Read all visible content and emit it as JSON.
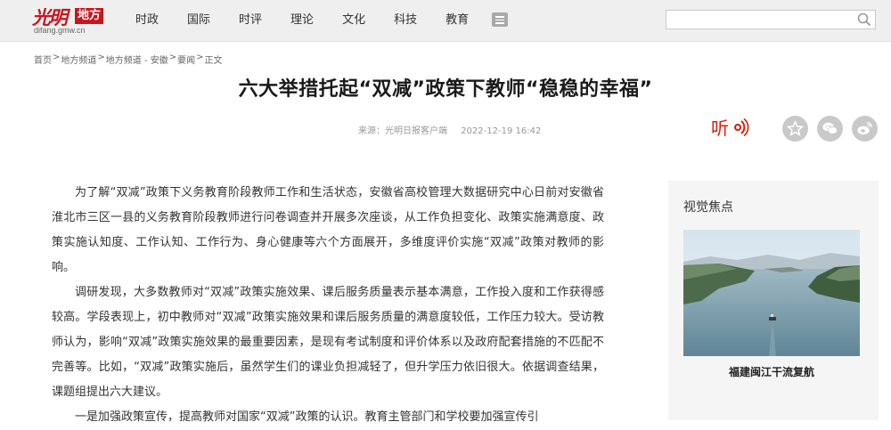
{
  "logo": {
    "brand": "光明",
    "box": "地方",
    "domain": "difang.gmw.cn"
  },
  "nav": [
    "时政",
    "国际",
    "时评",
    "理论",
    "文化",
    "科技",
    "教育"
  ],
  "search": {
    "placeholder": ""
  },
  "breadcrumb": [
    "首页",
    "地方频道",
    "地方频道 - 安徽",
    "要闻",
    "正文"
  ],
  "breadcrumb_separator": ">",
  "article": {
    "title": "六大举措托起“双减”政策下教师“稳稳的幸福”",
    "source_label": "来源：",
    "source": "光明日报客户端",
    "time": "2022-12-19 16:42",
    "listen_label": "听",
    "paragraphs": [
      "为了解“双减”政策下义务教育阶段教师工作和生活状态，安徽省高校管理大数据研究中心日前对安徽省淮北市三区一县的义务教育阶段教师进行问卷调查并开展多次座谈，从工作负担变化、政策实施满意度、政策实施认知度、工作认知、工作行为、身心健康等六个方面展开，多维度评价实施“双减”政策对教师的影响。",
      "调研发现，大多数教师对“双减”政策实施效果、课后服务质量表示基本满意，工作投入度和工作获得感较高。学段表现上，初中教师对“双减”政策实施效果和课后服务质量的满意度较低，工作压力较大。受访教师认为，影响“双减”政策实施效果的最重要因素，是现有考试制度和评价体系以及政府配套措施的不匹配不完善等。比如，“双减”政策实施后，虽然学生们的课业负担减轻了，但升学压力依旧很大。依据调查结果，课题组提出六大建议。",
      "一是加强政策宣传，提高教师对国家“双减”政策的认识。教育主管部门和学校要加强宣传引"
    ]
  },
  "sidebar": {
    "title": "视觉焦点",
    "caption": "福建闽江干流复航"
  },
  "colors": {
    "brand_red": "#c8161e",
    "topbar_bg": "#efefef",
    "sidebar_bg": "#f5f5f5"
  }
}
